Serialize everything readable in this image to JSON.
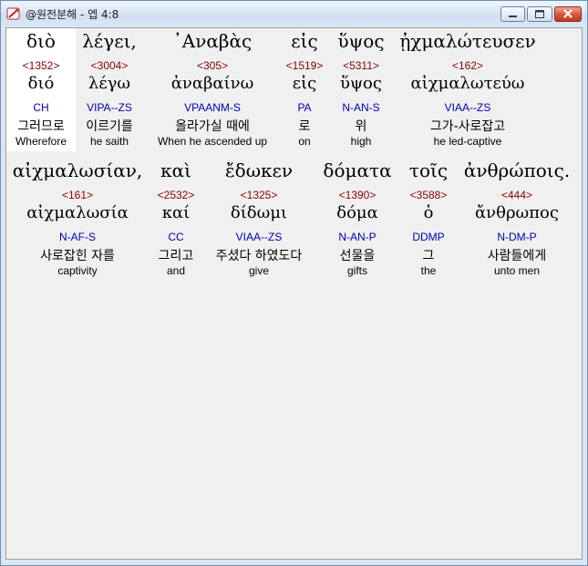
{
  "window": {
    "title": "@원전분해 - 엡 4:8"
  },
  "rows": [
    [
      {
        "greek": "διὸ",
        "strong": "<1352>",
        "lexeme": "διό",
        "parse": "CH",
        "korean": "그러므로",
        "english": "Wherefore"
      },
      {
        "greek": "λέγει,",
        "strong": "<3004>",
        "lexeme": "λέγω",
        "parse": "VIPA--ZS",
        "korean": "이르기를",
        "english": "he saith"
      },
      {
        "greek": "᾿Αναβὰς",
        "strong": "<305>",
        "lexeme": "ἀναβαίνω",
        "parse": "VPAANM-S",
        "korean": "올라가실 때에",
        "english": "When he ascended up"
      },
      {
        "greek": "εἰς",
        "strong": "<1519>",
        "lexeme": "εἰς",
        "parse": "PA",
        "korean": "로",
        "english": "on"
      },
      {
        "greek": "ὕψος",
        "strong": "<5311>",
        "lexeme": "ὕψος",
        "parse": "N-AN-S",
        "korean": "위",
        "english": "high"
      },
      {
        "greek": "ᾐχμαλώτευσεν",
        "strong": "<162>",
        "lexeme": "αἰχμαλωτεύω",
        "parse": "VIAA--ZS",
        "korean": "그가-사로잡고",
        "english": "he led-captive"
      }
    ],
    [
      {
        "greek": "αἰχμαλωσίαν,",
        "strong": "<161>",
        "lexeme": "αἰχμαλωσία",
        "parse": "N-AF-S",
        "korean": "사로잡힌 자를",
        "english": "captivity"
      },
      {
        "greek": "καὶ",
        "strong": "<2532>",
        "lexeme": "καί",
        "parse": "CC",
        "korean": "그리고",
        "english": "and"
      },
      {
        "greek": "ἔδωκεν",
        "strong": "<1325>",
        "lexeme": "δίδωμι",
        "parse": "VIAA--ZS",
        "korean": "주셨다 하였도다",
        "english": "give"
      },
      {
        "greek": "δόματα",
        "strong": "<1390>",
        "lexeme": "δόμα",
        "parse": "N-AN-P",
        "korean": "선물을",
        "english": "gifts"
      },
      {
        "greek": "τοῖς",
        "strong": "<3588>",
        "lexeme": "ὁ",
        "parse": "DDMP",
        "korean": "그",
        "english": "the"
      },
      {
        "greek": "ἀνθρώποις.",
        "strong": "<444>",
        "lexeme": "ἄνθρωπος",
        "parse": "N-DM-P",
        "korean": "사람들에게",
        "english": "unto men"
      }
    ]
  ],
  "colors": {
    "strong": "#8b0000",
    "parse": "#0000b0",
    "selected_bg": "#ffffff",
    "content_bg": "#f0f0f0"
  }
}
